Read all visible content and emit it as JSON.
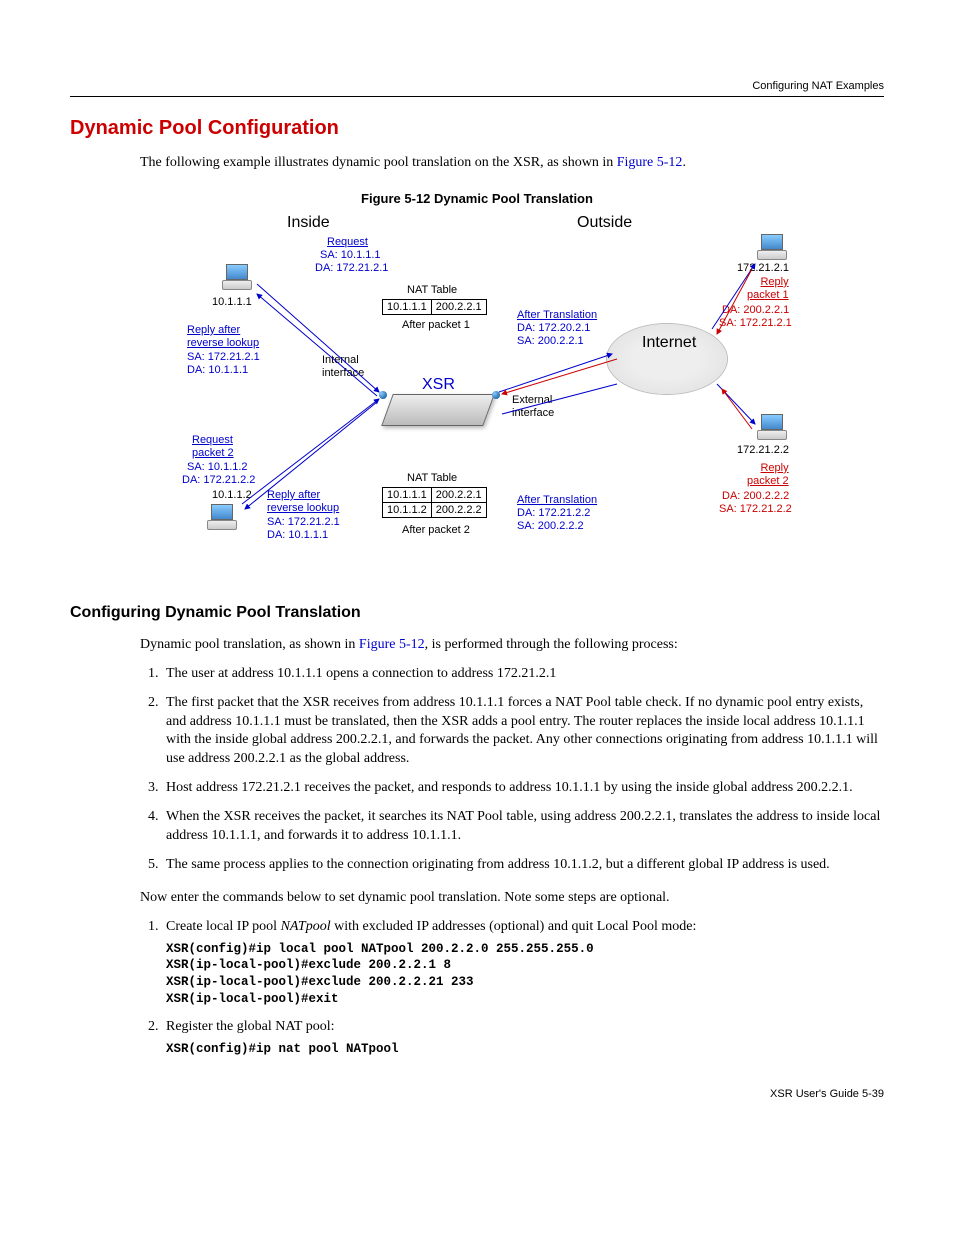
{
  "header": {
    "right": "Configuring NAT Examples"
  },
  "h1": "Dynamic Pool Configuration",
  "intro_prefix": "The following example illustrates dynamic pool translation on the XSR, as shown in ",
  "intro_link": "Figure 5-12",
  "intro_suffix": ".",
  "fig_caption": "Figure 5-12    Dynamic Pool Translation",
  "fig": {
    "inside": "Inside",
    "outside": "Outside",
    "internet": "Internet",
    "xsr": "XSR",
    "internal_if": "Internal\ninterface",
    "external_if": "External\ninterface",
    "nat_table_label": "NAT Table",
    "after_packet1": "After packet 1",
    "after_packet2": "After packet 2",
    "ip_10_1_1_1": "10.1.1.1",
    "ip_10_1_1_2": "10.1.1.2",
    "ip_172_21_2_1": "172.21.2.1",
    "ip_172_21_2_2": "172.21.2.2",
    "request": "Request",
    "request_sa1": "SA: 10.1.1.1",
    "request_da1": "DA: 172.21.2.1",
    "reply_after_rev": "Reply after\nreverse lookup",
    "rev_sa1": "SA: 172.21.2.1",
    "rev_da1": "DA: 10.1.1.1",
    "req_packet2": "Request\npacket 2",
    "req2_sa": "SA: 10.1.1.2",
    "req2_da": "DA: 172.21.2.2",
    "rev2_header": "Reply after\nreverse lookup",
    "rev2_sa": "SA: 172.21.2.1",
    "rev2_da": "DA: 10.1.1.1",
    "after_trans": "After Translation",
    "at1_da": "DA: 172.20.2.1",
    "at1_sa": "SA: 200.2.2.1",
    "at2_da": "DA: 172.21.2.2",
    "at2_sa": "SA: 200.2.2.2",
    "reply_packet1": "Reply\npacket 1",
    "rp1_da": "DA: 200.2.2.1",
    "rp1_sa": "SA: 172.21.2.1",
    "reply_packet2": "Reply\npacket 2",
    "rp2_da": "DA: 200.2.2.2",
    "rp2_sa": "SA: 172.21.2.2",
    "nat1_r1c1": "10.1.1.1",
    "nat1_r1c2": "200.2.2.1",
    "nat2_r1c1": "10.1.1.1",
    "nat2_r1c2": "200.2.2.1",
    "nat2_r2c1": "10.1.1.2",
    "nat2_r2c2": "200.2.2.2"
  },
  "h2": "Configuring Dynamic Pool Translation",
  "p2_prefix": "Dynamic pool translation, as shown in ",
  "p2_link": "Figure 5-12",
  "p2_suffix": ", is performed through the following process:",
  "steps1": {
    "s1": "The user at address 10.1.1.1 opens a connection to address 172.21.2.1",
    "s2": "The first packet that the XSR receives from address 10.1.1.1 forces a NAT Pool table check. If no dynamic pool entry exists, and address 10.1.1.1 must be translated, then the XSR adds a pool entry. The router replaces the inside local address 10.1.1.1 with the inside global address 200.2.2.1, and forwards the packet. Any other connections originating from address 10.1.1.1 will use address 200.2.2.1 as the global address.",
    "s3": "Host address 172.21.2.1 receives the packet, and responds to address 10.1.1.1 by using the inside global address 200.2.2.1.",
    "s4": "When the XSR receives the packet, it searches its NAT Pool table, using address 200.2.2.1, translates the address to inside local address 10.1.1.1, and forwards it to address 10.1.1.1.",
    "s5": "The same process applies to the connection originating from address 10.1.1.2, but a different global IP address is used."
  },
  "p3": "Now enter the commands below to set dynamic pool translation. Note some steps are optional.",
  "steps2": {
    "s1_text_prefix": "Create local IP pool ",
    "s1_text_ital": "NATpool",
    "s1_text_suffix": " with excluded IP addresses (optional) and quit Local Pool mode:",
    "s1_code1": "XSR(config)#ip local pool NATpool 200.2.2.0 255.255.255.0",
    "s1_code2": "XSR(ip-local-pool)#exclude 200.2.2.1 8",
    "s1_code3": "XSR(ip-local-pool)#exclude 200.2.2.21 233",
    "s1_code4": "XSR(ip-local-pool)#exit",
    "s2_text": "Register the global NAT pool:",
    "s2_code1": "XSR(config)#ip nat pool NATpool"
  },
  "footer": "XSR User's Guide    5-39"
}
